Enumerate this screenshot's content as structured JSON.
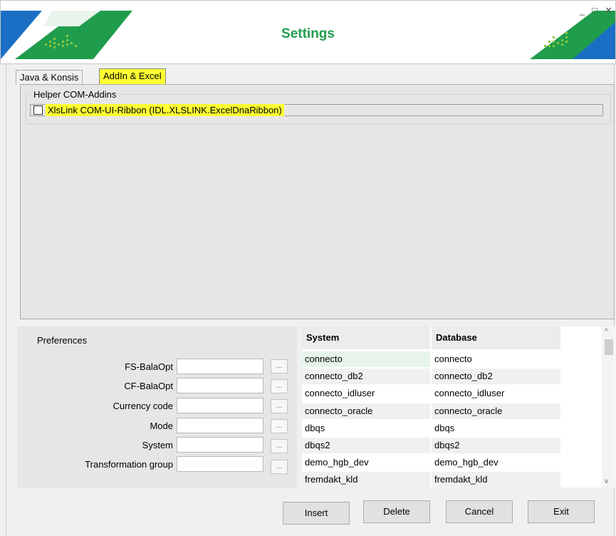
{
  "header": {
    "title": "Settings",
    "controls": {
      "minimize": "_",
      "maximize": "□",
      "close": "✕"
    },
    "accent_color": "#1f9d4c",
    "brand_blue": "#1a6fc4"
  },
  "tabs": [
    {
      "label": "Java & Konsis",
      "active": false
    },
    {
      "label": "AddIn & Excel",
      "active": true
    }
  ],
  "helper_group": {
    "label": "Helper COM-Addins",
    "items": [
      {
        "label": "XlsLink COM-UI-Ribbon (IDL.XLSLINK.ExcelDnaRibbon)",
        "checked": false
      }
    ]
  },
  "preferences": {
    "title": "Preferences",
    "fields": [
      {
        "label": "FS-BalaOpt",
        "value": "",
        "button": "..."
      },
      {
        "label": "CF-BalaOpt",
        "value": "",
        "button": "..."
      },
      {
        "label": "Currency code",
        "value": "",
        "button": "..."
      },
      {
        "label": "Mode",
        "value": "",
        "button": "..."
      },
      {
        "label": "System",
        "value": "",
        "button": "..."
      },
      {
        "label": "Transformation group",
        "value": "",
        "button": "..."
      }
    ]
  },
  "grid": {
    "columns": [
      "System",
      "Database"
    ],
    "rows": [
      [
        "connecto",
        "connecto"
      ],
      [
        "connecto_db2",
        "connecto_db2"
      ],
      [
        "connecto_idluser",
        "connecto_idluser"
      ],
      [
        "connecto_oracle",
        "connecto_oracle"
      ],
      [
        "dbqs",
        "dbqs"
      ],
      [
        "dbqs2",
        "dbqs2"
      ],
      [
        "demo_hgb_dev",
        "demo_hgb_dev"
      ],
      [
        "fremdakt_kld",
        "fremdakt_kld"
      ]
    ],
    "scroll_up": "^",
    "scroll_down": "v"
  },
  "buttons": {
    "insert": "Insert",
    "delete": "Delete",
    "cancel": "Cancel",
    "exit": "Exit"
  }
}
